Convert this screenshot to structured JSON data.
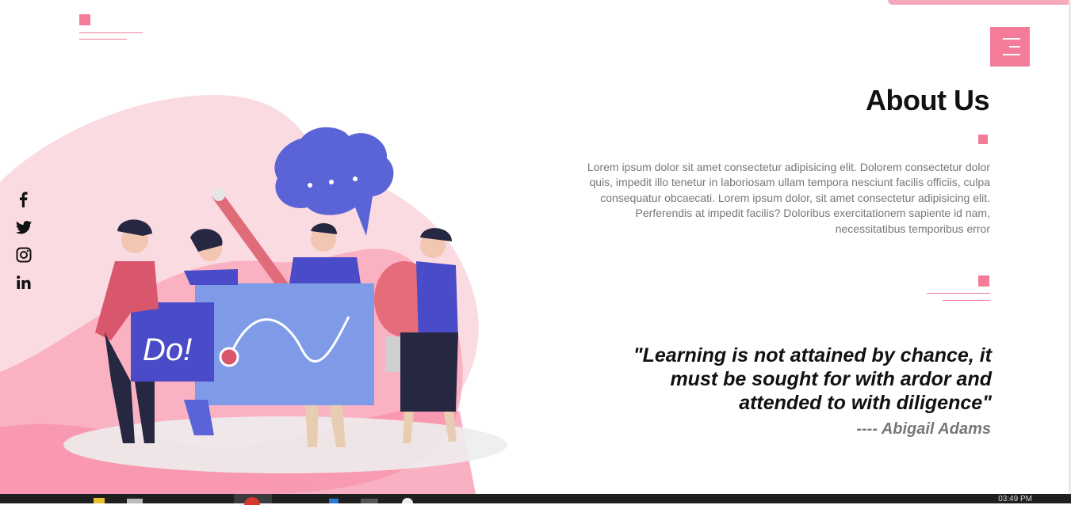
{
  "about": {
    "title": "About Us",
    "paragraph": "Lorem ipsum dolor sit amet consectetur adipisicing elit. Dolorem consectetur dolor quis, impedit illo tenetur in laboriosam ullam tempora nesciunt facilis officiis, culpa consequatur obcaecati. Lorem ipsum dolor, sit amet consectetur adipisicing elit. Perferendis at impedit facilis? Doloribus exercitationem sapiente id nam, necessitatibus temporibus error"
  },
  "quote": {
    "text": "\"Learning is not attained by chance, it must be sought for with ardor and attended to with diligence\"",
    "author": "---- Abigail Adams"
  },
  "illustration": {
    "sign_text": "Do!"
  },
  "social": [
    "facebook-icon",
    "twitter-icon",
    "instagram-icon",
    "linkedin-icon"
  ],
  "colors": {
    "accent": "#f47c98",
    "blob": "#fbd3dc",
    "illustration_blue": "#5b5bd6"
  },
  "taskbar": {
    "clock": "03:49 PM"
  }
}
